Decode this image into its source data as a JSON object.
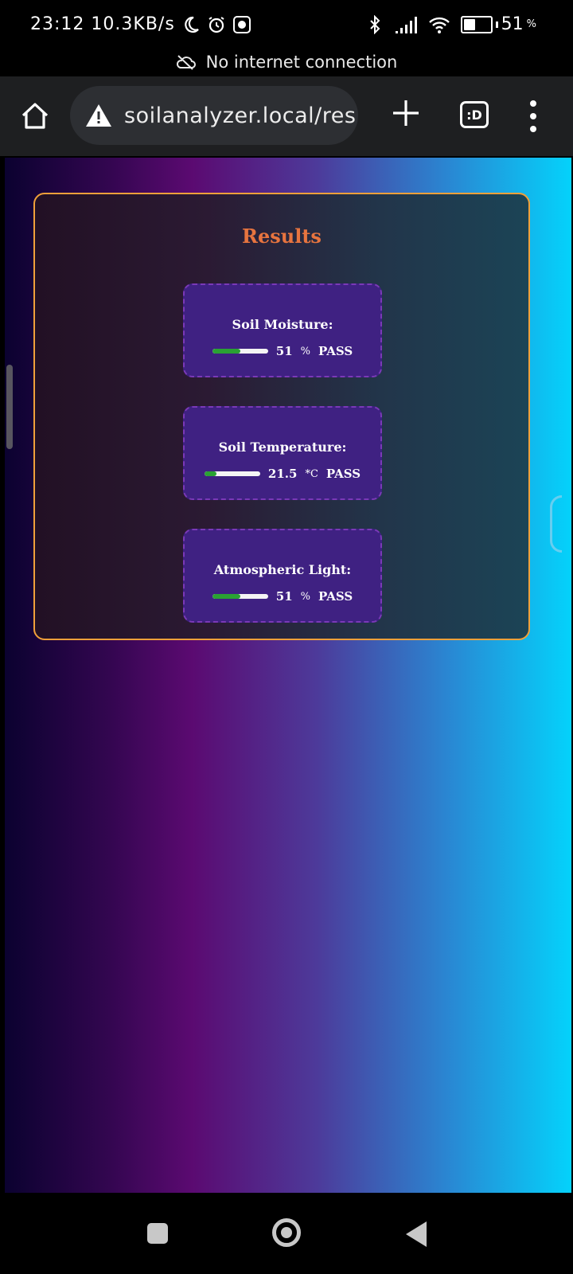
{
  "status_bar": {
    "time": "23:12",
    "speed": "10.3KB/s",
    "battery_percent": "51",
    "battery_percent_sign": "%",
    "battery_level": 0.51,
    "icons": [
      "moon-icon",
      "alarm-icon",
      "app-notification-icon",
      "bluetooth-icon",
      "signal-icon",
      "wifi-icon",
      "battery-icon"
    ]
  },
  "notice": {
    "text": "No internet connection",
    "icon": "cloud-off-icon"
  },
  "browser": {
    "url": "soilanalyzer.local/res",
    "tabs_label": ":D",
    "icons": [
      "home-icon",
      "warning-icon",
      "plus-icon",
      "tab-switcher-icon",
      "overflow-menu-icon"
    ]
  },
  "results": {
    "title": "Results",
    "metrics": [
      {
        "label": "Soil Moisture:",
        "value": "51",
        "unit": "%",
        "status": "PASS",
        "level": 0.51
      },
      {
        "label": "Soil Temperature:",
        "value": "21.5",
        "unit": "*C",
        "status": "PASS",
        "level": 0.215
      },
      {
        "label": "Atmospheric Light:",
        "value": "51",
        "unit": "%",
        "status": "PASS",
        "level": 0.51
      }
    ]
  },
  "colors": {
    "card_border": "#f0a03a",
    "title": "#e7743f",
    "metric_box": "#3f2182",
    "bar_fill": "#2aa233"
  }
}
